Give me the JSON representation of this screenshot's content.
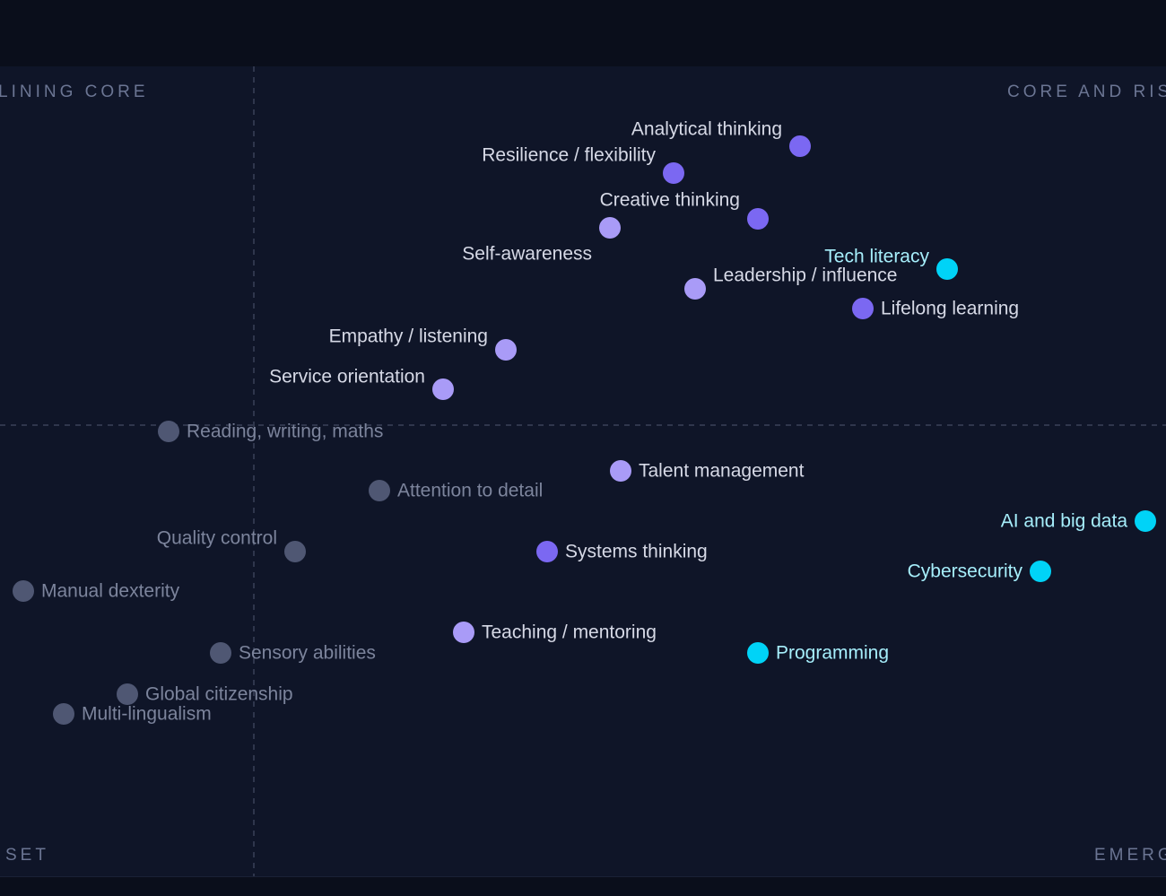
{
  "colors": {
    "background": "#0f1528",
    "core": "#7b68f2",
    "human": "#a99bf7",
    "tech": "#00d3f7",
    "declining": "#4f5773",
    "quadrant_label": "#6b7593",
    "divider": "#3a4258"
  },
  "quadrant_labels": {
    "top_left": "LINING CORE",
    "top_right": "CORE AND RIS",
    "bottom_left": "SET",
    "bottom_right": "EMERG"
  },
  "chart_data": {
    "type": "scatter",
    "grid": false,
    "legend": "none",
    "xlim": [
      0,
      1300
    ],
    "ylim": [
      74,
      977
    ],
    "dividers": {
      "x": 283,
      "y": 474
    },
    "points": [
      {
        "label": "Analytical thinking",
        "x": 892,
        "y": 163,
        "group": "core",
        "label_side": "left",
        "label_dy": -19
      },
      {
        "label": "Resilience / flexibility",
        "x": 751,
        "y": 193,
        "group": "core",
        "label_side": "left",
        "label_dy": -20
      },
      {
        "label": "Creative thinking",
        "x": 845,
        "y": 244,
        "group": "core",
        "label_side": "left",
        "label_dy": -21
      },
      {
        "label": "Self-awareness",
        "x": 680,
        "y": 254,
        "group": "human",
        "label_side": "left",
        "label_dy": 29
      },
      {
        "label": "Tech literacy",
        "x": 1056,
        "y": 300,
        "group": "tech",
        "label_side": "left",
        "label_dy": -14
      },
      {
        "label": "Leadership / influence",
        "x": 775,
        "y": 322,
        "group": "human",
        "label_side": "right",
        "label_dy": -15
      },
      {
        "label": "Lifelong learning",
        "x": 962,
        "y": 344,
        "group": "core",
        "label_side": "right",
        "label_dy": 0
      },
      {
        "label": "Empathy / listening",
        "x": 564,
        "y": 390,
        "group": "human",
        "label_side": "left",
        "label_dy": -15
      },
      {
        "label": "Service orientation",
        "x": 494,
        "y": 434,
        "group": "human",
        "label_side": "left",
        "label_dy": -14
      },
      {
        "label": "Reading, writing, maths",
        "x": 188,
        "y": 481,
        "group": "declining",
        "label_side": "right",
        "label_dy": 0
      },
      {
        "label": "Talent management",
        "x": 692,
        "y": 525,
        "group": "human",
        "label_side": "right",
        "label_dy": 0
      },
      {
        "label": "Attention to detail",
        "x": 423,
        "y": 547,
        "group": "declining",
        "label_side": "right",
        "label_dy": 0
      },
      {
        "label": "AI and big data",
        "x": 1277,
        "y": 581,
        "group": "tech",
        "label_side": "left",
        "label_dy": 0
      },
      {
        "label": "Quality control",
        "x": 329,
        "y": 615,
        "group": "declining",
        "label_side": "left",
        "label_dy": -15
      },
      {
        "label": "Systems thinking",
        "x": 610,
        "y": 615,
        "group": "core",
        "label_side": "right",
        "label_dy": 0
      },
      {
        "label": "Cybersecurity",
        "x": 1160,
        "y": 637,
        "group": "tech",
        "label_side": "left",
        "label_dy": 0
      },
      {
        "label": "Manual dexterity",
        "x": 26,
        "y": 659,
        "group": "declining",
        "label_side": "right",
        "label_dy": 0
      },
      {
        "label": "Teaching / mentoring",
        "x": 517,
        "y": 705,
        "group": "human",
        "label_side": "right",
        "label_dy": 0
      },
      {
        "label": "Sensory abilities",
        "x": 246,
        "y": 728,
        "group": "declining",
        "label_side": "right",
        "label_dy": 0
      },
      {
        "label": "Programming",
        "x": 845,
        "y": 728,
        "group": "tech",
        "label_side": "right",
        "label_dy": 0
      },
      {
        "label": "Global citizenship",
        "x": 142,
        "y": 774,
        "group": "declining",
        "label_side": "right",
        "label_dy": 0
      },
      {
        "label": "Multi-lingualism",
        "x": 71,
        "y": 796,
        "group": "declining",
        "label_side": "right",
        "label_dy": 0
      }
    ]
  }
}
